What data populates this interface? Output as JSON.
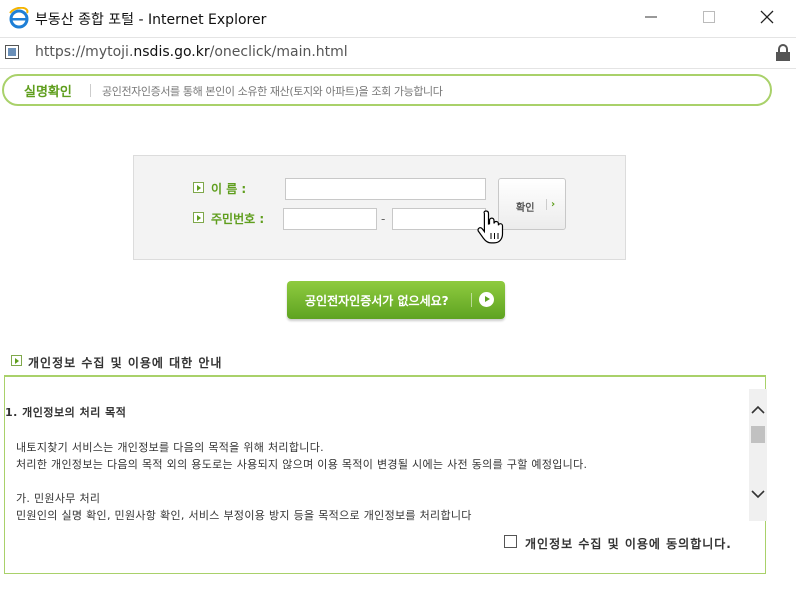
{
  "window": {
    "title": "부동산 종합 포털 - Internet Explorer",
    "url_prefix": "https://mytoji.",
    "url_host": "nsdis.go.kr",
    "url_path": "/oneclick/main.html"
  },
  "banner": {
    "title": "실명확인",
    "description": "공인전자인증서를 통해 본인이 소유한 재산(토지와 아파트)을 조회 가능합니다"
  },
  "login": {
    "name_label": "이      름 :",
    "name_value": "",
    "ssn_label": "주민번호 :",
    "ssn_first": "",
    "ssn_dash": "-",
    "ssn_second": "",
    "confirm_label": "확인",
    "confirm_arrow": "›"
  },
  "cert_button": {
    "label": "공인전자인증서가 없으세요?"
  },
  "privacy": {
    "heading": "개인정보 수집 및 이용에 대한 안내",
    "section_title": "1. 개인정보의 처리 목적",
    "paragraphs": [
      "내토지찾기 서비스는 개인정보를 다음의 목적을 위해 처리합니다.",
      "처리한 개인정보는 다음의 목적 외의 용도로는 사용되지 않으며 이용 목적이 변경될 시에는 사전 동의를 구할 예정입니다.",
      "가. 민원사무 처리",
      " 민원인의 실명 확인, 민원사항 확인, 서비스 부정이용 방지 등을 목적으로 개인정보를 처리합니다"
    ],
    "agree_label": "개인정보 수집 및 이용에 동의합니다.",
    "agree_checked": false
  },
  "colors": {
    "accent_green": "#5f9e1d",
    "banner_border": "#a9d16a"
  },
  "icons": [
    "ie-logo-icon",
    "minimize-icon",
    "maximize-icon",
    "close-icon",
    "page-icon",
    "lock-icon",
    "arrow-bullet-icon",
    "hand-cursor-icon",
    "scroll-up-icon",
    "scroll-down-icon"
  ]
}
